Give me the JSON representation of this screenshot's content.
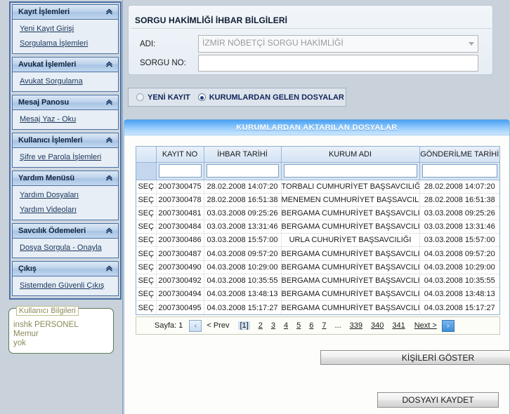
{
  "sidebar": {
    "groups": [
      {
        "title": "Kayıt İşlemleri",
        "icon": "chevron-double-up-icon",
        "links": [
          "Yeni Kayıt Girişi",
          "Sorgulama İşlemleri"
        ]
      },
      {
        "title": "Avukat İşlemleri",
        "icon": "chevron-double-up-icon",
        "links": [
          "Avukat Sorgulama"
        ]
      },
      {
        "title": "Mesaj Panosu",
        "icon": "chevron-double-up-icon",
        "links": [
          "Mesaj Yaz - Oku"
        ]
      },
      {
        "title": "Kullanıcı İşlemleri",
        "icon": "chevron-double-up-icon",
        "links": [
          "Şifre ve Parola İşlemleri"
        ]
      },
      {
        "title": "Yardım Menüsü",
        "icon": "chevron-double-up-icon",
        "links": [
          "Yardım Dosyaları",
          "Yardım Videoları"
        ]
      },
      {
        "title": "Savcılık Ödemeleri",
        "icon": "chevron-double-up-icon",
        "links": [
          "Dosya Sorgula - Onayla"
        ]
      },
      {
        "title": "Çıkış",
        "icon": "chevron-double-up-icon",
        "links": [
          "Sistemden Güvenli Çıkış"
        ]
      }
    ],
    "user_box": {
      "legend": "Kullanıcı Bilgileri",
      "line1": "inshk PERSONEL",
      "line2": "Memur",
      "line3": "yok"
    }
  },
  "info_panel": {
    "title": "SORGU HAKİMLİĞİ İHBAR BİLGİLERİ",
    "adi_label": "ADI:",
    "adi_value": "İZMİR NÖBETÇİ SORGU HAKİMLİĞİ",
    "adi_icon": "chevron-down-icon",
    "sorgu_no_label": "SORGU NO:",
    "sorgu_no_value": "",
    "sorgu_no_placeholder": ""
  },
  "mode_radio": {
    "options": [
      {
        "label": "YENİ KAYIT",
        "checked": false
      },
      {
        "label": "KURUMLARDAN GELEN DOSYALAR",
        "checked": true
      }
    ]
  },
  "table_panel": {
    "title": "KURUMLARDAN AKTARILAN DOSYALAR",
    "columns": [
      "",
      "KAYIT NO",
      "İHBAR TARİHİ",
      "KURUM ADI",
      "GÖNDERİLME TARİHİ"
    ],
    "filter_values": [
      "",
      "",
      "",
      "",
      ""
    ],
    "select_label": "SEÇ",
    "rows": [
      {
        "sec": "SEÇ",
        "kayit_no": "2007300475",
        "ihbar_tarihi": "28.02.2008 14:07:20",
        "kurum_adi": "TORBALI CUMHURİYET BAŞSAVCILIĞI",
        "gonderilme_tarihi": "28.02.2008 14:07:20"
      },
      {
        "sec": "SEÇ",
        "kayit_no": "2007300478",
        "ihbar_tarihi": "28.02.2008 16:51:38",
        "kurum_adi": "MENEMEN CUMHURİYET BAŞSAVCILIĞI",
        "gonderilme_tarihi": "28.02.2008 16:51:38"
      },
      {
        "sec": "SEÇ",
        "kayit_no": "2007300481",
        "ihbar_tarihi": "03.03.2008 09:25:26",
        "kurum_adi": "BERGAMA CUMHURİYET BAŞSAVCILIĞI",
        "gonderilme_tarihi": "03.03.2008 09:25:26"
      },
      {
        "sec": "SEÇ",
        "kayit_no": "2007300484",
        "ihbar_tarihi": "03.03.2008 13:31:46",
        "kurum_adi": "BERGAMA CUMHURİYET BAŞSAVCILIĞI",
        "gonderilme_tarihi": "03.03.2008 13:31:46"
      },
      {
        "sec": "SEÇ",
        "kayit_no": "2007300486",
        "ihbar_tarihi": "03.03.2008 15:57:00",
        "kurum_adi": "URLA CUHURİYET BAŞSAVCILIĞI",
        "gonderilme_tarihi": "03.03.2008 15:57:00"
      },
      {
        "sec": "SEÇ",
        "kayit_no": "2007300487",
        "ihbar_tarihi": "04.03.2008 09:57:20",
        "kurum_adi": "BERGAMA CUMHURİYET BAŞSAVCILIĞI",
        "gonderilme_tarihi": "04.03.2008 09:57:20"
      },
      {
        "sec": "SEÇ",
        "kayit_no": "2007300490",
        "ihbar_tarihi": "04.03.2008 10:29:00",
        "kurum_adi": "BERGAMA CUMHURİYET BAŞSAVCILIĞI",
        "gonderilme_tarihi": "04.03.2008 10:29:00"
      },
      {
        "sec": "SEÇ",
        "kayit_no": "2007300492",
        "ihbar_tarihi": "04.03.2008 10:35:55",
        "kurum_adi": "BERGAMA CUMHURİYET BAŞSAVCILIĞI",
        "gonderilme_tarihi": "04.03.2008 10:35:55"
      },
      {
        "sec": "SEÇ",
        "kayit_no": "2007300494",
        "ihbar_tarihi": "04.03.2008 13:48:13",
        "kurum_adi": "BERGAMA CUMHURİYET BAŞSAVCILIĞI",
        "gonderilme_tarihi": "04.03.2008 13:48:13"
      },
      {
        "sec": "SEÇ",
        "kayit_no": "2007300495",
        "ihbar_tarihi": "04.03.2008 15:17:27",
        "kurum_adi": "BERGAMA CUMHURİYET BAŞSAVCILIĞI",
        "gonderilme_tarihi": "04.03.2008 15:17:27"
      }
    ]
  },
  "pager": {
    "page_label": "Sayfa: 1",
    "first_icon": "chevron-left-icon",
    "prev_label": "< Prev",
    "current_page": "[1]",
    "pages": [
      "2",
      "3",
      "4",
      "5",
      "6",
      "7"
    ],
    "ellipsis": "...",
    "tail_pages": [
      "339",
      "340",
      "341"
    ],
    "next_label": "Next >",
    "last_icon": "chevron-right-icon"
  },
  "buttons": {
    "show_persons": "KİŞİLERİ GÖSTER",
    "save_file": "DOSYAYI KAYDET"
  },
  "colors": {
    "page_bg": "#c9d2da",
    "menu_border": "#4a6fa5",
    "menu_header_blue": "#a8c4e4",
    "title_bar_blue": "#79bdfa",
    "link_text": "#17365d",
    "radio_dot": "#1b3c87",
    "grid_border": "#92b0d2",
    "user_text": "#8a8a5a"
  }
}
